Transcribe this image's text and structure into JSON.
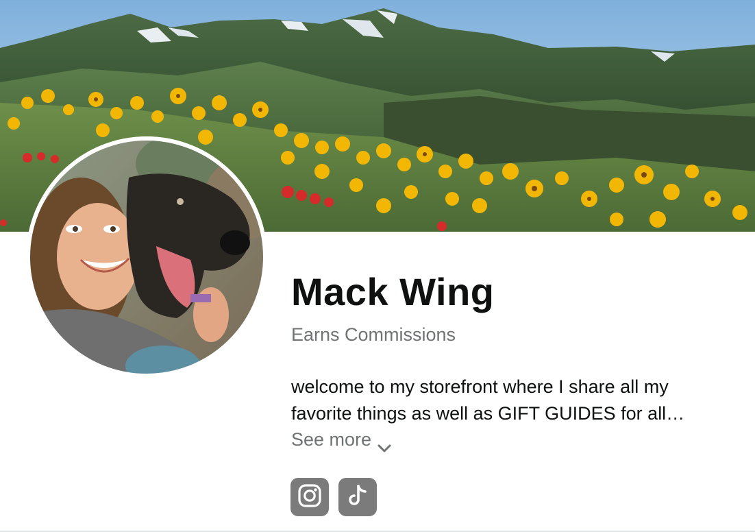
{
  "banner": {
    "alt_icon": "mountain-meadow-banner"
  },
  "profile": {
    "avatar_icon": "profile-photo-with-dog",
    "name": "Mack Wing",
    "subtitle": "Earns Commissions",
    "bio_line_1": "welcome to my storefront where I share all my",
    "bio_line_2": "favorite things as well as GIFT GUIDES for all…",
    "see_more_label": "See more"
  },
  "socials": [
    {
      "icon": "instagram-icon"
    },
    {
      "icon": "tiktok-icon"
    }
  ],
  "colors": {
    "text_primary": "#0f1111",
    "text_secondary": "#6f7373",
    "social_bg": "#7b7b7b",
    "sky": "#9cc4e4",
    "mountain": "#3d5a36",
    "flower": "#f2b705"
  }
}
